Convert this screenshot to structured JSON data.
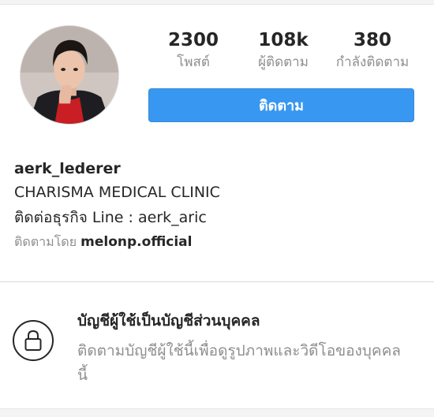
{
  "profile": {
    "username": "aerk_lederer",
    "bio_lines": [
      "CHARISMA MEDICAL CLINIC",
      "ติดต่อธุรกิจ Line : aerk_aric"
    ],
    "followed_by_label": "ติดตามโดย",
    "followed_by_account": "melonp.official"
  },
  "stats": {
    "posts": {
      "value": "2300",
      "label": "โพสต์"
    },
    "followers": {
      "value": "108k",
      "label": "ผู้ติดตาม"
    },
    "following": {
      "value": "380",
      "label": "กำลังติดตาม"
    }
  },
  "follow_button": {
    "label": "ติดตาม"
  },
  "private_notice": {
    "title": "บัญชีผู้ใช้เป็นบัญชีส่วนบุคคล",
    "description": "ติดตามบัญชีผู้ใช้นี้เพื่อดูรูปภาพและวิดีโอของบุคคลนี้"
  },
  "icons": {
    "avatar": "profile-photo",
    "lock": "lock-icon"
  },
  "colors": {
    "accent": "#3897f0",
    "text": "#262626",
    "muted": "#8e8e8e"
  }
}
